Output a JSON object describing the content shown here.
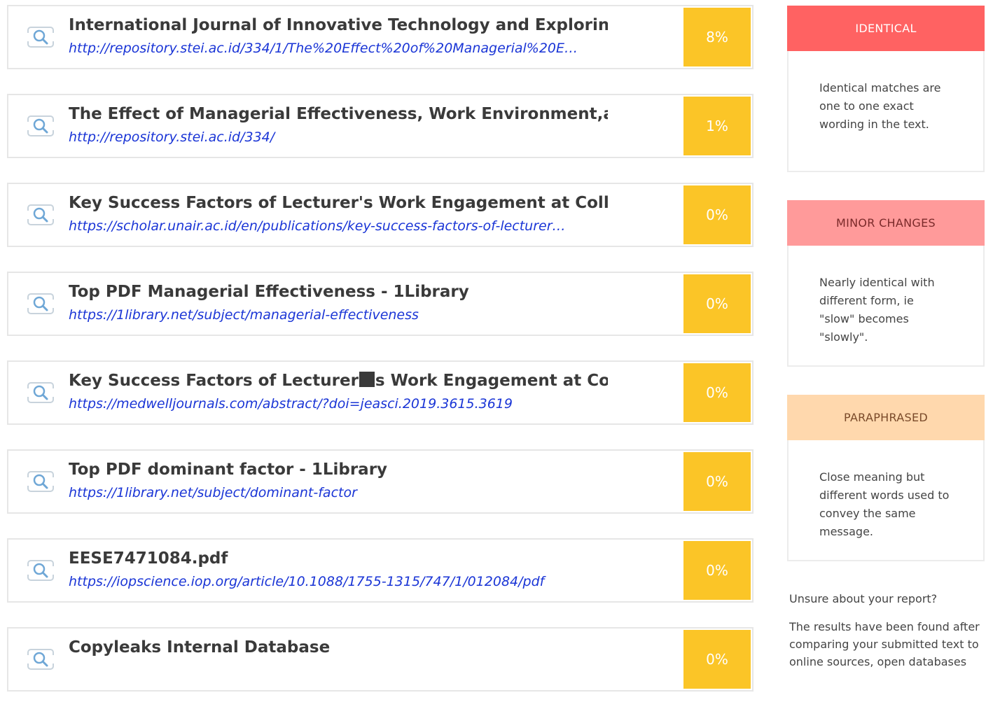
{
  "results": [
    {
      "title": "International Journal of Innovative Technology and Explorin…",
      "url": "http://repository.stei.ac.id/334/1/The%20Effect%20of%20Managerial%20E…",
      "percent": "8%"
    },
    {
      "title": "The Effect of Managerial Effectiveness, Work Environment,a…",
      "url": "http://repository.stei.ac.id/334/",
      "percent": "1%"
    },
    {
      "title": "Key Success Factors of Lecturer's Work Engagement at Colle…",
      "url": "https://scholar.unair.ac.id/en/publications/key-success-factors-of-lecturer…",
      "percent": "0%"
    },
    {
      "title": "Top PDF Managerial Effectiveness - 1Library",
      "url": "https://1library.net/subject/managerial-effectiveness",
      "percent": "0%"
    },
    {
      "title_before": "Key Success Factors of Lecturer",
      "title_after": "s Work Engagement at Col…",
      "url": "https://medwelljournals.com/abstract/?doi=jeasci.2019.3615.3619",
      "percent": "0%"
    },
    {
      "title": "Top PDF dominant factor - 1Library",
      "url": "https://1library.net/subject/dominant-factor",
      "percent": "0%"
    },
    {
      "title": "EESE7471084.pdf",
      "url": "https://iopscience.iop.org/article/10.1088/1755-1315/747/1/012084/pdf",
      "percent": "0%"
    },
    {
      "title": "Copyleaks Internal Database",
      "url": "",
      "percent": "0%"
    }
  ],
  "legend": {
    "identical": {
      "label": "IDENTICAL",
      "desc": "Identical matches are one to one exact wording in the text.",
      "color": "#ff6262"
    },
    "minor": {
      "label": "MINOR CHANGES",
      "desc": "Nearly identical with different form, ie \"slow\" becomes \"slowly\".",
      "color": "#ff9a9a"
    },
    "paraphrased": {
      "label": "PARAPHRASED",
      "desc": "Close meaning but different words used to convey the same message.",
      "color": "#ffd8ad"
    }
  },
  "note": {
    "heading": "Unsure about your report?",
    "body": "The results have been found after comparing your submitted text to online sources, open databases"
  },
  "colors": {
    "percent_badge": "#fbc527",
    "link": "#1a35d6"
  },
  "icons": {
    "result": "search-document-icon"
  }
}
